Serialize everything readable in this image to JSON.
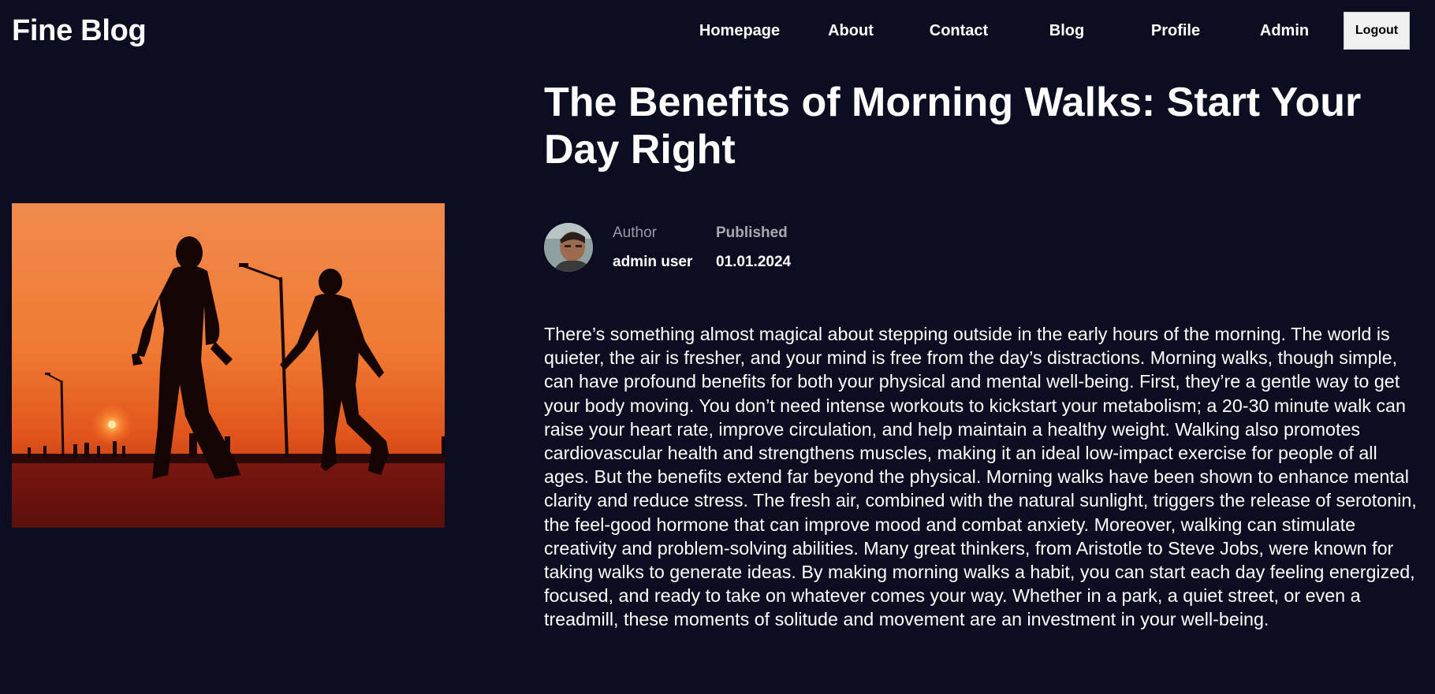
{
  "header": {
    "brand": "Fine Blog",
    "nav": [
      "Homepage",
      "About",
      "Contact",
      "Blog",
      "Profile",
      "Admin"
    ],
    "logout_label": "Logout"
  },
  "post": {
    "title": "The Benefits of Morning Walks: Start Your Day Right",
    "author_label": "Author",
    "author_name": "admin user",
    "published_label": "Published",
    "published_date": "01.01.2024",
    "body": "There’s something almost magical about stepping outside in the early hours of the morning. The world is quieter, the air is fresher, and your mind is free from the day’s distractions. Morning walks, though simple, can have profound benefits for both your physical and mental well-being. First, they’re a gentle way to get your body moving. You don’t need intense workouts to kickstart your metabolism; a 20-30 minute walk can raise your heart rate, improve circulation, and help maintain a healthy weight. Walking also promotes cardiovascular health and strengthens muscles, making it an ideal low-impact exercise for people of all ages. But the benefits extend far beyond the physical. Morning walks have been shown to enhance mental clarity and reduce stress. The fresh air, combined with the natural sunlight, triggers the release of serotonin, the feel-good hormone that can improve mood and combat anxiety. Moreover, walking can stimulate creativity and problem-solving abilities. Many great thinkers, from Aristotle to Steve Jobs, were known for taking walks to generate ideas. By making morning walks a habit, you can start each day feeling energized, focused, and ready to take on whatever comes your way. Whether in a park, a quiet street, or even a treadmill, these moments of solitude and movement are an investment in your well-being."
  },
  "colors": {
    "background": "#0d0d21",
    "text": "#ffffff",
    "muted": "#9a9aa6",
    "logout_bg": "#f0f0f0"
  }
}
